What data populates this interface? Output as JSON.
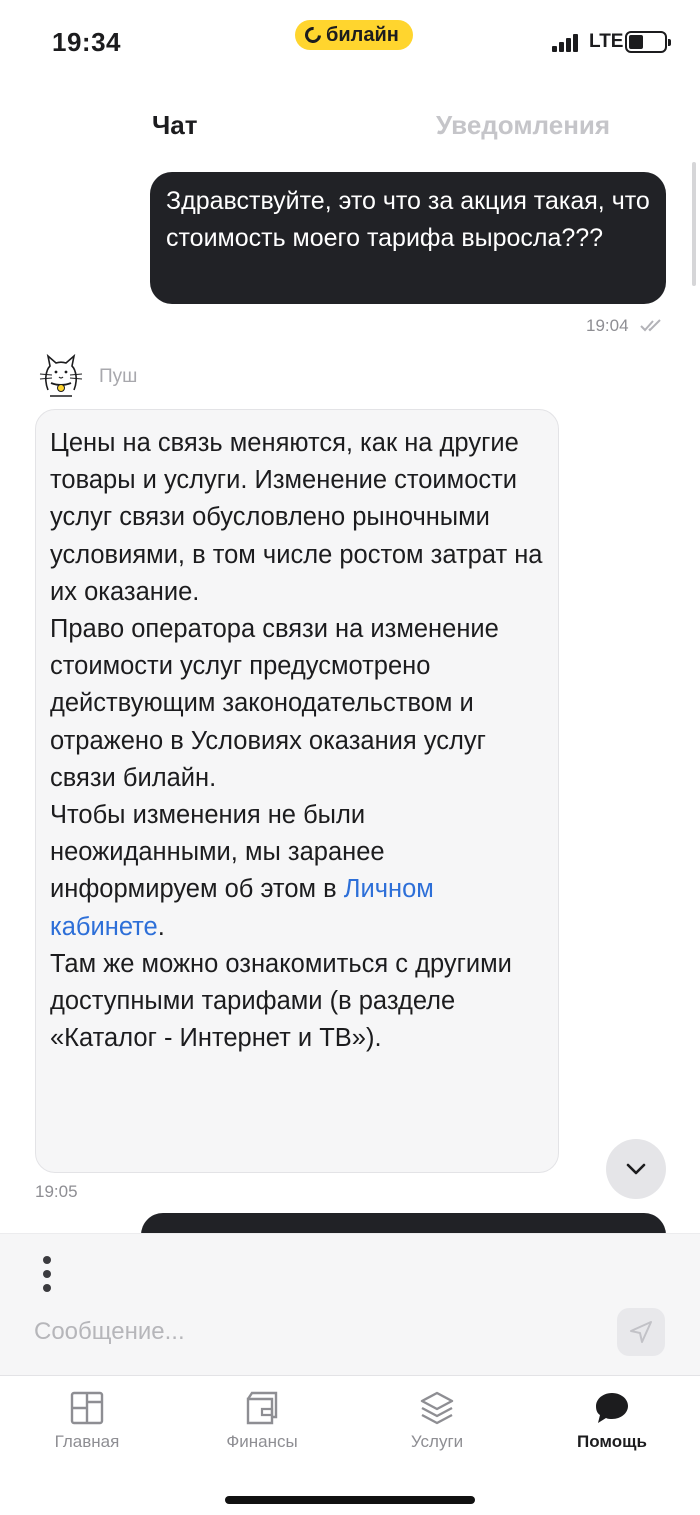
{
  "status_bar": {
    "time": "19:34",
    "carrier": "билайн",
    "network": "LTE",
    "battery_level": 0.4
  },
  "tabs": [
    {
      "label": "Чат",
      "active": true
    },
    {
      "label": "Уведомления",
      "active": false
    }
  ],
  "messages": {
    "outgoing_1": {
      "text": "Здравствуйте, это что за акция такая, что стоимость моего тарифа выросла???",
      "time": "19:04",
      "read": true
    },
    "bot": {
      "name": "Пуш",
      "paragraph_1": "Цены на связь меняются, как на другие товары и услуги. Изменение стоимости услуг связи обусловлено рыночными условиями, в том числе ростом затрат на их оказание.",
      "paragraph_2": "Право оператора связи на изменение стоимости услуг предусмотрено действующим законодательством и отражено в Условиях оказания услуг связи билайн.",
      "paragraph_3_before_link": "Чтобы изменения не были неожиданными, мы заранее информируем об этом в ",
      "paragraph_3_link": "Личном кабинете",
      "paragraph_3_after_link": ".",
      "paragraph_4": "Там же можно ознакомиться с другими доступными тарифами (в разделе «Каталог - Интернет и ТВ»).",
      "time": "19:05"
    }
  },
  "composer": {
    "placeholder": "Сообщение..."
  },
  "bottom_nav": [
    {
      "label": "Главная",
      "icon": "home-grid-icon",
      "active": false
    },
    {
      "label": "Финансы",
      "icon": "wallet-icon",
      "active": false
    },
    {
      "label": "Услуги",
      "icon": "layers-icon",
      "active": false
    },
    {
      "label": "Помощь",
      "icon": "chat-bubble-icon",
      "active": true
    }
  ],
  "colors": {
    "brand_yellow": "#ffd52e",
    "outgoing_bubble": "#212226",
    "incoming_bubble": "#f6f6f7",
    "link": "#2d6fd8"
  }
}
